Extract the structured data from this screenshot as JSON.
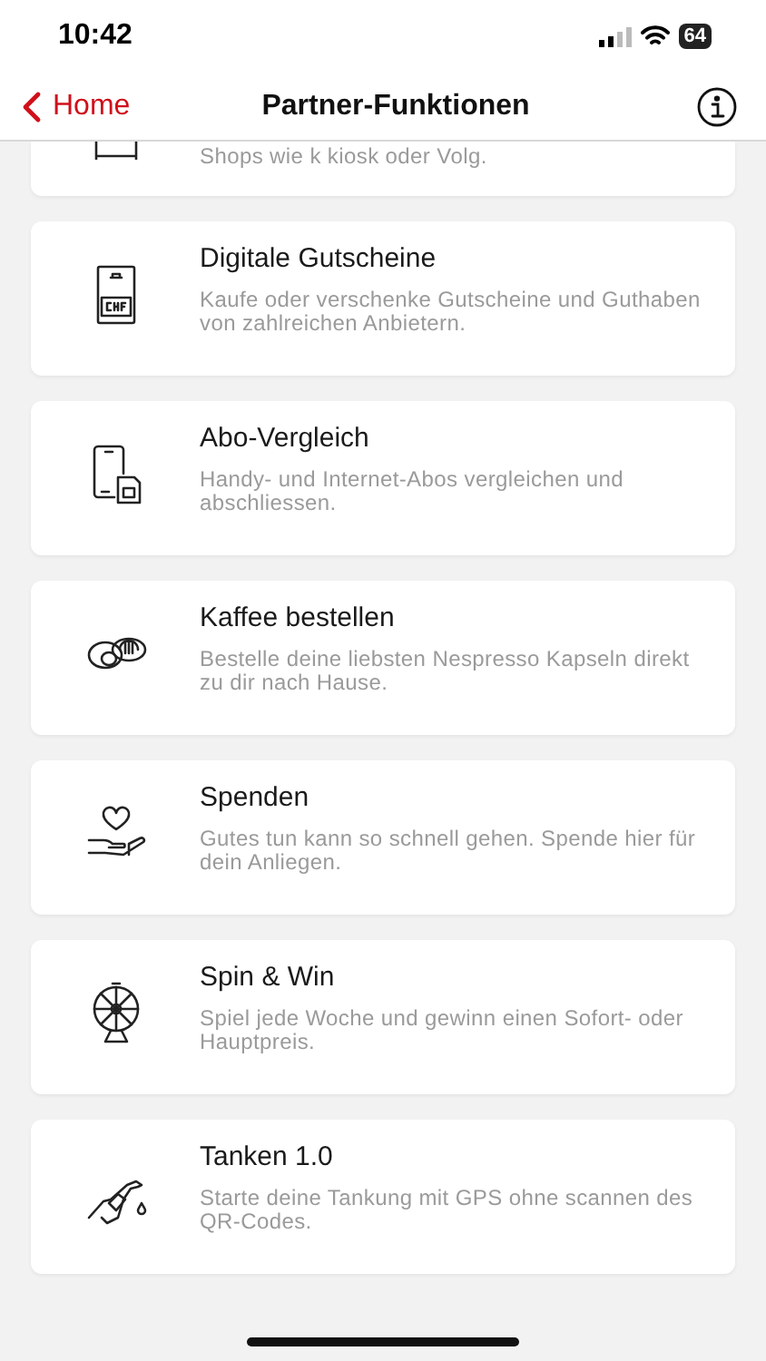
{
  "status_bar": {
    "time": "10:42",
    "battery": "64"
  },
  "nav": {
    "back": "Home",
    "title": "Partner-Funktionen"
  },
  "cut_card": {
    "description": "Shops wie k kiosk oder Volg."
  },
  "cards": [
    {
      "title": "Digitale Gutscheine",
      "description": "Kaufe oder verschenke Gutscheine und Guthaben von zahlreichen Anbietern."
    },
    {
      "title": "Abo-Vergleich",
      "description": "Handy- und Internet-Abos vergleichen und abschliessen."
    },
    {
      "title": "Kaffee bestellen",
      "description": "Bestelle deine liebsten Nespresso Kapseln direkt zu dir nach Hause."
    },
    {
      "title": "Spenden",
      "description": "Gutes tun kann so schnell gehen. Spende hier für dein Anliegen."
    },
    {
      "title": "Spin & Win",
      "description": "Spiel jede Woche und gewinn einen Sofort- oder Hauptpreis."
    },
    {
      "title": "Tanken 1.0",
      "description": "Starte deine Tankung mit GPS ohne scannen des QR-Codes."
    }
  ]
}
